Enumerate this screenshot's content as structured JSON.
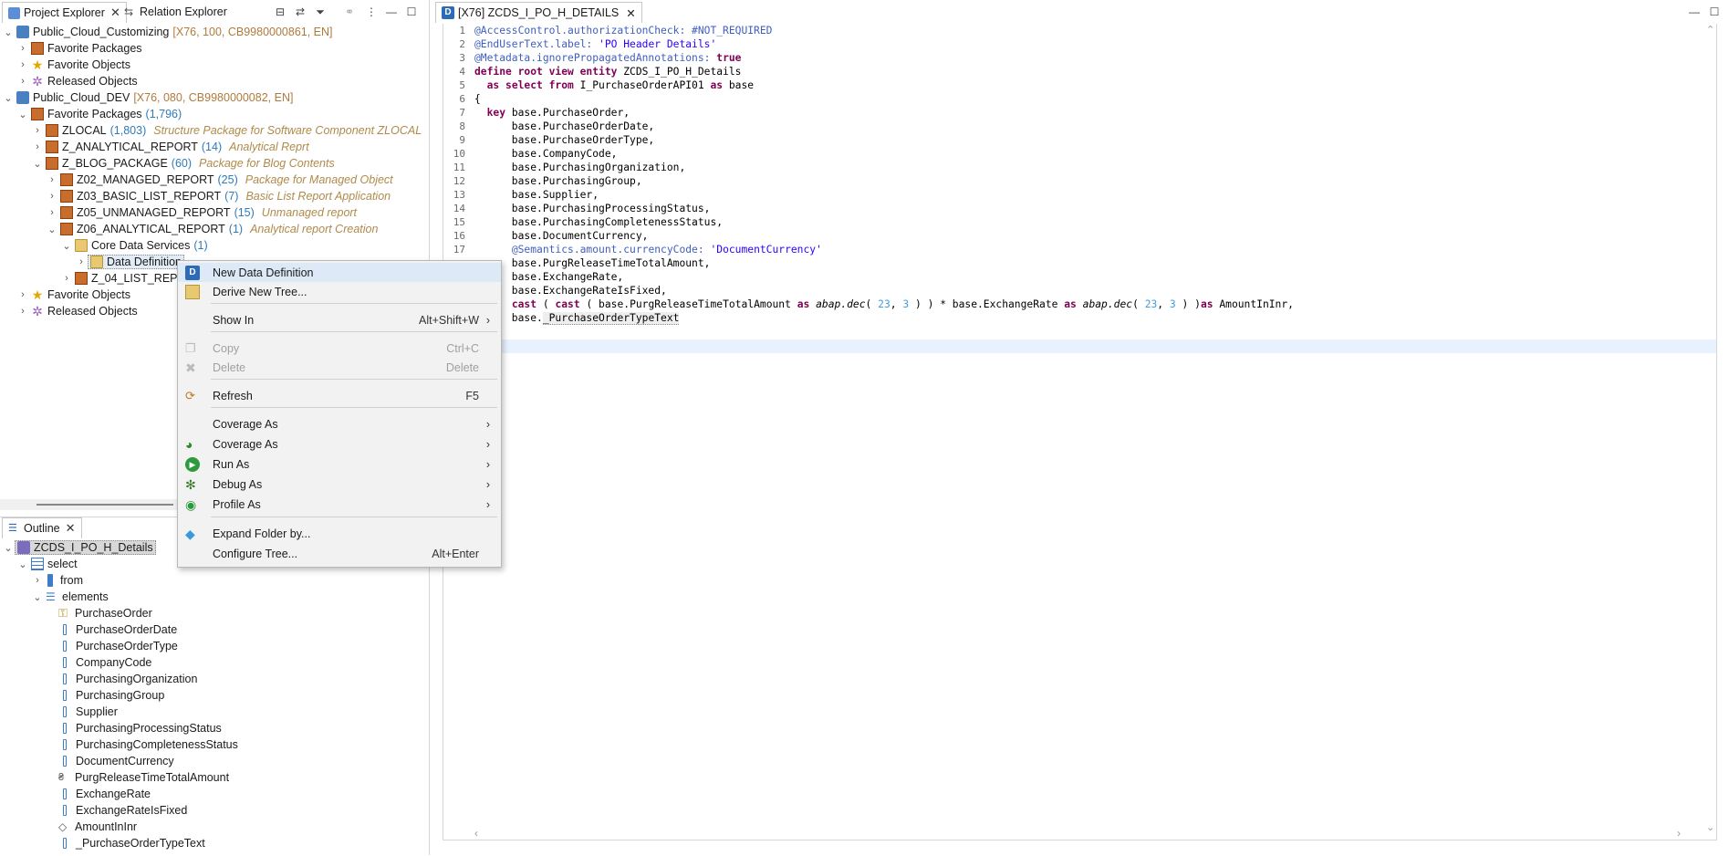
{
  "left_tabs": {
    "project_explorer": "Project Explorer",
    "relation_explorer": "Relation Explorer"
  },
  "tree": {
    "cust_project": "Public_Cloud_Customizing",
    "cust_meta": "[X76, 100, CB9980000861, EN]",
    "fav_packages": "Favorite Packages",
    "fav_objects": "Favorite Objects",
    "released_objects": "Released Objects",
    "dev_project": "Public_Cloud_DEV",
    "dev_meta": "[X76, 080, CB9980000082, EN]",
    "dev_fav_packages": "Favorite Packages",
    "dev_fav_count": "(1,796)",
    "pkgs": [
      {
        "name": "ZLOCAL",
        "count": "(1,803)",
        "desc": "Structure Package for Software Component ZLOCAL"
      },
      {
        "name": "Z_ANALYTICAL_REPORT",
        "count": "(14)",
        "desc": "Analytical Reprt"
      },
      {
        "name": "Z_BLOG_PACKAGE",
        "count": "(60)",
        "desc": "Package for Blog Contents"
      },
      {
        "name": "Z02_MANAGED_REPORT",
        "count": "(25)",
        "desc": "Package for Managed Object"
      },
      {
        "name": "Z03_BASIC_LIST_REPORT",
        "count": "(7)",
        "desc": "Basic List Report Application"
      },
      {
        "name": "Z05_UNMANAGED_REPORT",
        "count": "(15)",
        "desc": "Unmanaged report"
      },
      {
        "name": "Z06_ANALYTICAL_REPORT",
        "count": "(1)",
        "desc": "Analytical report Creation"
      }
    ],
    "cds": "Core Data Services",
    "cds_count": "(1)",
    "data_def": "Data Definition",
    "list_report": "Z_04_LIST_REPORT_U",
    "dev_fav_objects": "Favorite Objects",
    "dev_released": "Released Objects"
  },
  "outline": {
    "tab": "Outline",
    "root": "ZCDS_I_PO_H_Details",
    "select": "select",
    "from": "from",
    "elements": "elements",
    "items": [
      "PurchaseOrder",
      "PurchaseOrderDate",
      "PurchaseOrderType",
      "CompanyCode",
      "PurchasingOrganization",
      "PurchasingGroup",
      "Supplier",
      "PurchasingProcessingStatus",
      "PurchasingCompletenessStatus",
      "DocumentCurrency",
      "PurgReleaseTimeTotalAmount",
      "ExchangeRate",
      "ExchangeRateIsFixed",
      "AmountInInr",
      "_PurchaseOrderTypeText"
    ]
  },
  "editor": {
    "tab": "[X76] ZCDS_I_PO_H_DETAILS",
    "line_numbers": [
      "1",
      "2",
      "3",
      "4",
      "5",
      "6",
      "7",
      "8",
      "9",
      "10",
      "11",
      "12",
      "13",
      "14",
      "15",
      "16",
      "17",
      "18",
      "19",
      "20",
      "21",
      "22",
      "23"
    ]
  },
  "menu": {
    "new_data_definition": "New Data Definition",
    "derive_new_tree": "Derive New Tree...",
    "show_in": "Show In",
    "show_in_sc": "Alt+Shift+W",
    "copy": "Copy",
    "copy_sc": "Ctrl+C",
    "delete": "Delete",
    "delete_sc": "Delete",
    "refresh": "Refresh",
    "refresh_sc": "F5",
    "coverage_as_1": "Coverage As",
    "coverage_as_2": "Coverage As",
    "run_as": "Run As",
    "debug_as": "Debug As",
    "profile_as": "Profile As",
    "expand_folder": "Expand Folder by...",
    "configure_tree": "Configure Tree...",
    "configure_tree_sc": "Alt+Enter"
  }
}
